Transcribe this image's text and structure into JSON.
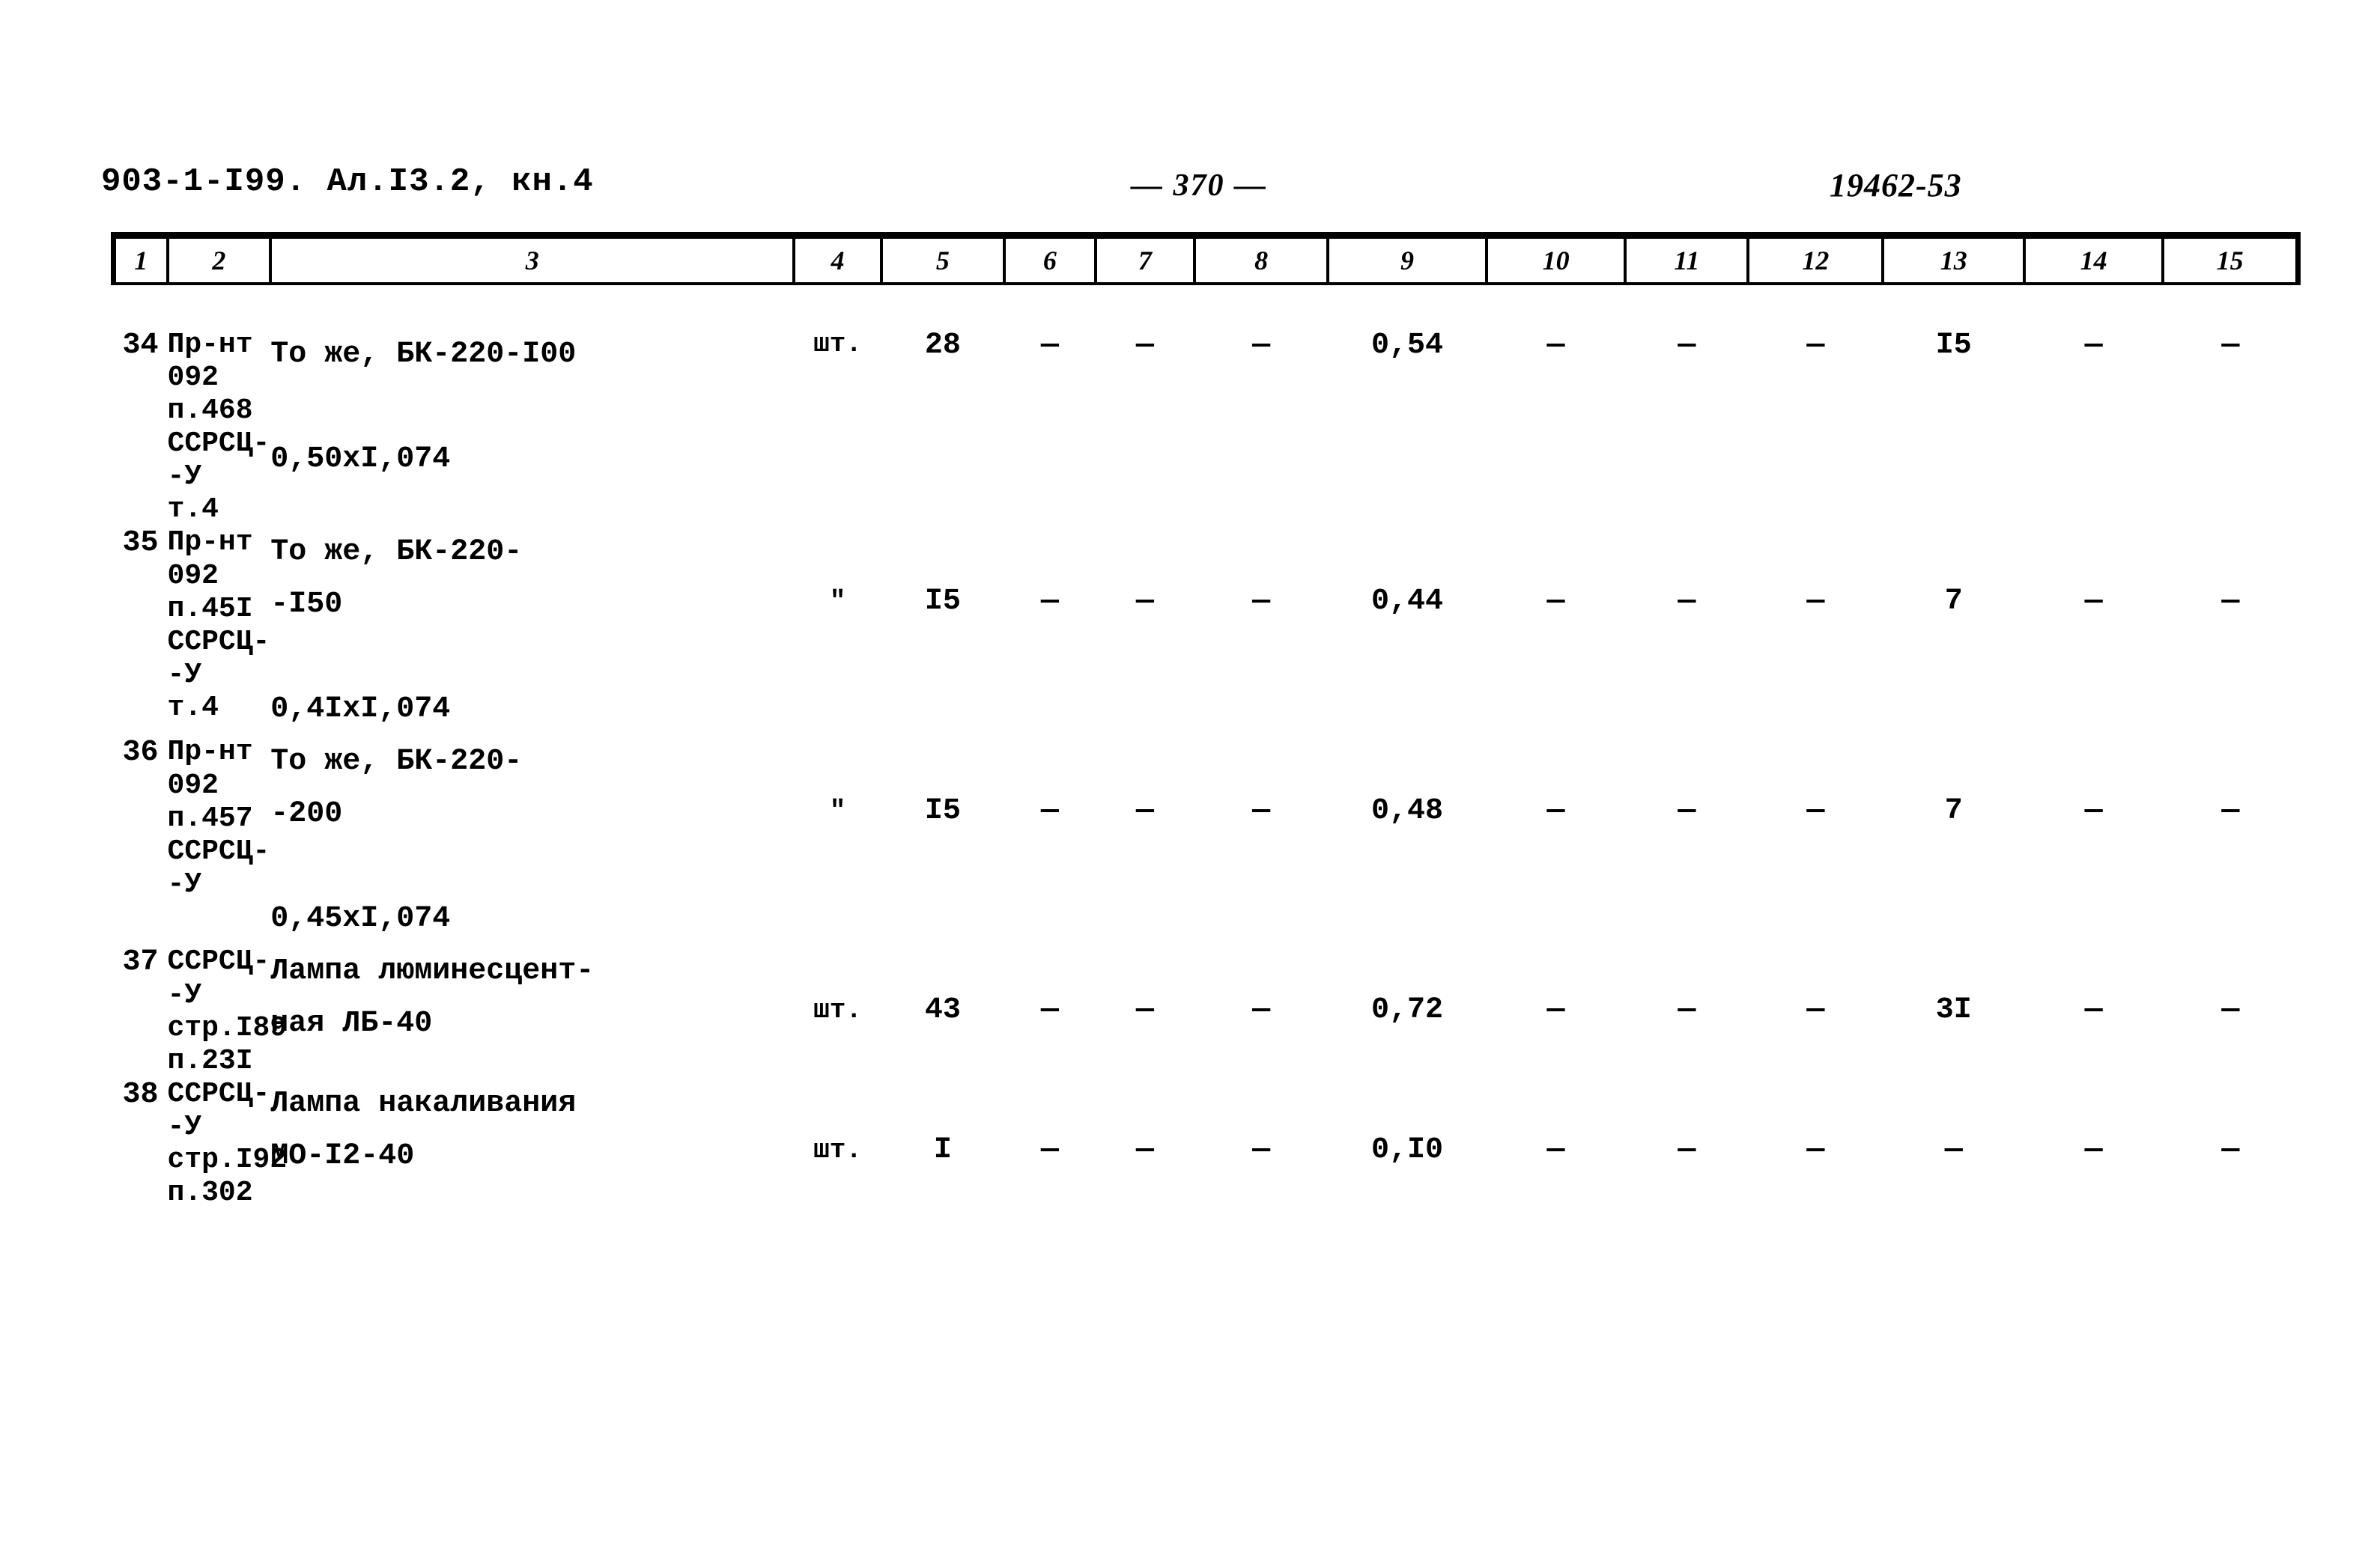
{
  "header": {
    "doc_code": "903-1-I99. Ал.I3.2, кн.4",
    "page_number": "— 370 —",
    "archive_stamp": "19462-53"
  },
  "table": {
    "column_headers": [
      "1",
      "2",
      "3",
      "4",
      "5",
      "6",
      "7",
      "8",
      "9",
      "10",
      "11",
      "12",
      "13",
      "14",
      "15"
    ],
    "rows": [
      {
        "num": "34",
        "code": "Пр-нт\n092\nп.468\nССРСЦ-\n-У\nт.4",
        "description": "То же, БК-220-I00\n\n0,50хI,074",
        "unit": "шт.",
        "c5": "28",
        "c6": "—",
        "c7": "—",
        "c8": "—",
        "c9": "0,54",
        "c10": "—",
        "c11": "—",
        "c12": "—",
        "c13": "I5",
        "c14": "—",
        "c15": "—"
      },
      {
        "num": "35",
        "code": "Пр-нт\n092\nп.45I\nССРСЦ-\n-У\nт.4",
        "description": "То же, БК-220-\n-I50\n\n0,4IхI,074",
        "unit": "\"",
        "c5": "I5",
        "c6": "—",
        "c7": "—",
        "c8": "—",
        "c9": "0,44",
        "c10": "—",
        "c11": "—",
        "c12": "—",
        "c13": "7",
        "c14": "—",
        "c15": "—"
      },
      {
        "num": "36",
        "code": "Пр-нт\n092\nп.457\nССРСЦ-\n-У",
        "description": "То же, БК-220-\n-200\n\n0,45хI,074",
        "unit": "\"",
        "c5": "I5",
        "c6": "—",
        "c7": "—",
        "c8": "—",
        "c9": "0,48",
        "c10": "—",
        "c11": "—",
        "c12": "—",
        "c13": "7",
        "c14": "—",
        "c15": "—"
      },
      {
        "num": "37",
        "code": "ССРСЦ-\n-У\nстр.I89\nп.23I",
        "description": "Лампа люминесцент-\nная  ЛБ-40",
        "unit": "шт.",
        "c5": "43",
        "c6": "—",
        "c7": "—",
        "c8": "—",
        "c9": "0,72",
        "c10": "—",
        "c11": "—",
        "c12": "—",
        "c13": "3I",
        "c14": "—",
        "c15": "—"
      },
      {
        "num": "38",
        "code": "ССРСЦ-\n-У\nстр.I92\nп.302",
        "description": "Лампа накаливания\nМО-I2-40",
        "unit": "шт.",
        "c5": "I",
        "c6": "—",
        "c7": "—",
        "c8": "—",
        "c9": "0,I0",
        "c10": "—",
        "c11": "—",
        "c12": "—",
        "c13": "—",
        "c14": "—",
        "c15": "—"
      }
    ]
  }
}
